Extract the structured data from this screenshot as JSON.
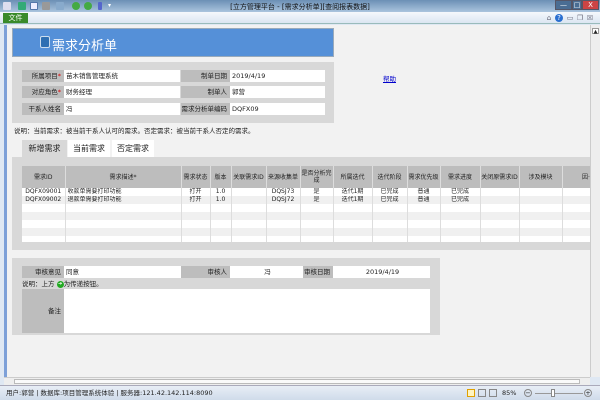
{
  "window": {
    "title": "[立方管理平台 - [需求分析单][查阅报表数据]",
    "minimize": "—",
    "maximize": "□",
    "close": "X"
  },
  "ribbon": {
    "file_tab": "文件",
    "icons": [
      "app-menu-icon",
      "save-icon",
      "document-icon",
      "print-icon",
      "preview-icon",
      "user-add-icon",
      "user-icon",
      "split-icon",
      "dropdown-icon"
    ],
    "right_icons": [
      "collapse-ribbon-icon",
      "help-icon",
      "minimize-doc-icon",
      "restore-doc-icon",
      "close-doc-icon"
    ]
  },
  "banner": {
    "title": "需求分析单",
    "icon": "document-stack-icon"
  },
  "form": {
    "project_label": "所属项目",
    "project_value": "苗木销售管理系统",
    "date_label": "制单日期",
    "date_value": "2019/4/19",
    "role_label": "对应角色",
    "role_value": "财务经理",
    "maker_label": "制单人",
    "maker_value": "郭营",
    "stakeholder_label": "干系人姓名",
    "stakeholder_value": "冯",
    "code_label": "需求分析单编码",
    "code_value": "DQFX09",
    "required_mark": "*"
  },
  "help_link": "帮助",
  "note": "说明：当前需求：被当前干系人认可的需求。否定需求：被当前干系人否定的需求。",
  "tabs": [
    {
      "label": "新增需求",
      "selected": true
    },
    {
      "label": "当前需求"
    },
    {
      "label": "否定需求"
    }
  ],
  "grid": {
    "columns": [
      "需求ID",
      "需求描述*",
      "需求状态",
      "版本",
      "关联需求ID",
      "来源收集单",
      "是否分析完成",
      "所属迭代",
      "迭代阶段",
      "需求优先级",
      "需求进度",
      "关闭原需求ID",
      "涉及模块",
      "因·关闭"
    ],
    "rows": [
      [
        "DQFX09001",
        "收款单需要打印功能",
        "打开",
        "1.0",
        "",
        "DQSJ73",
        "是",
        "迭代1期",
        "已完成",
        "普通",
        "已完成",
        "",
        "",
        ""
      ],
      [
        "DQFX09002",
        "退款单需要打印功能",
        "打开",
        "1.0",
        "",
        "DQSJ72",
        "是",
        "迭代1期",
        "已完成",
        "普通",
        "已完成",
        "",
        "",
        ""
      ]
    ],
    "empty_rows": 12
  },
  "review": {
    "opinion_label": "审核意见",
    "opinion_value": "同意",
    "reviewer_label": "审核人",
    "reviewer_value": "冯",
    "review_date_label": "审核日期",
    "review_date_value": "2019/4/19",
    "note_prefix": "说明：上方",
    "note_suffix": "为传递按钮。",
    "remark_label": "备注",
    "remark_value": ""
  },
  "status_bar": {
    "text": "用户:郭营 | 数据库:项目管理系统体验 | 服务器:121.42.142.114:8090",
    "zoom": "85%",
    "zoom_minus": "−",
    "zoom_plus": "+"
  }
}
